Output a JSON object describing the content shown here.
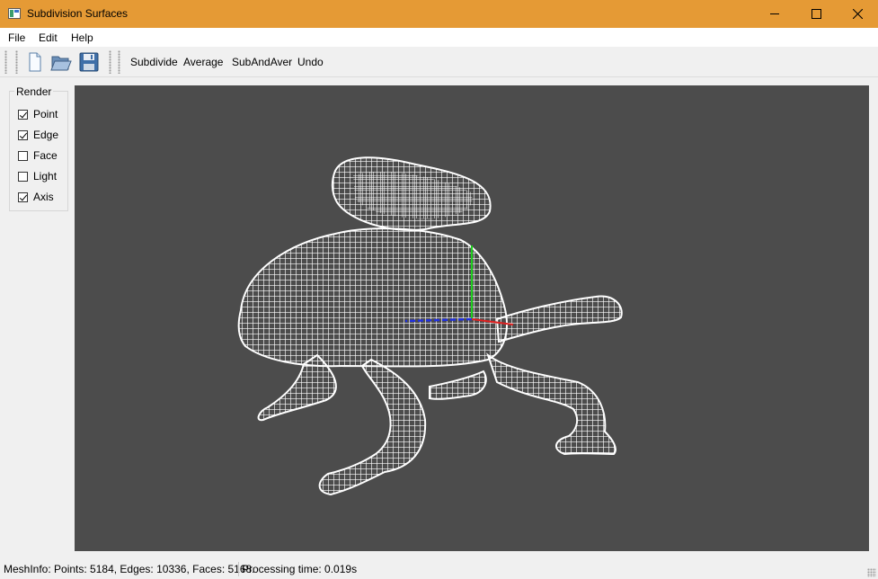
{
  "window": {
    "title": "Subdivision Surfaces"
  },
  "menu": [
    "File",
    "Edit",
    "Help"
  ],
  "toolbar": {
    "icons": [
      "new-file-icon",
      "open-folder-icon",
      "save-icon"
    ],
    "actions": [
      "Subdivide",
      "Average",
      "SubAndAver",
      "Undo"
    ]
  },
  "render": {
    "title": "Render",
    "options": [
      {
        "label": "Point",
        "checked": true
      },
      {
        "label": "Edge",
        "checked": true
      },
      {
        "label": "Face",
        "checked": false
      },
      {
        "label": "Light",
        "checked": false
      },
      {
        "label": "Axis",
        "checked": true
      }
    ]
  },
  "status": {
    "mesh_info": "MeshInfo: Points: 5184, Edges: 10336, Faces: 5168.",
    "processing": "Processing time: 0.019s"
  },
  "colors": {
    "titlebar": "#e59a35",
    "viewport_bg": "#4c4c4c",
    "mesh": "#ffffff",
    "axis_x": "#e02020",
    "axis_y": "#20d020",
    "axis_z": "#2030e0"
  }
}
